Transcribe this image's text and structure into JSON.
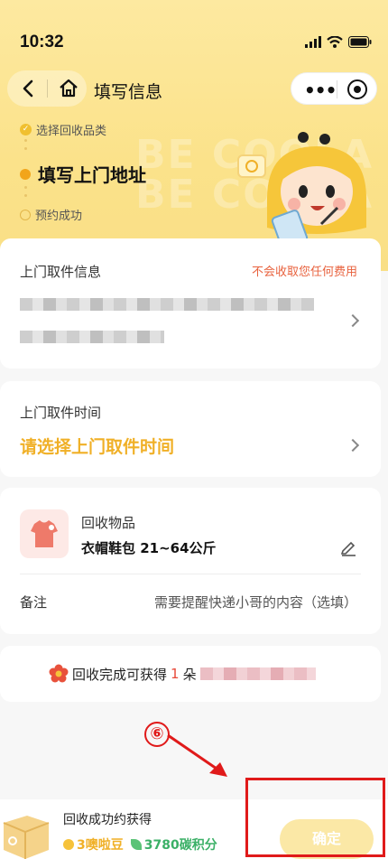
{
  "status_bar": {
    "time": "10:32"
  },
  "nav": {
    "title": "填写信息"
  },
  "steps": [
    {
      "label": "选择回收品类",
      "state": "done"
    },
    {
      "label": "填写上门地址",
      "state": "current"
    },
    {
      "label": "预约成功",
      "state": "pending"
    }
  ],
  "pickup_info": {
    "label": "上门取件信息",
    "fee_note": "不会收取您任何费用"
  },
  "pickup_time": {
    "label": "上门取件时间",
    "placeholder": "请选择上门取件时间"
  },
  "recycle_item": {
    "label": "回收物品",
    "value": "衣帽鞋包  21~64公斤"
  },
  "remark": {
    "label": "备注",
    "placeholder": "需要提醒快递小哥的内容（选填）"
  },
  "reward": {
    "prefix": "回收完成可获得",
    "count": "1",
    "unit": "朵"
  },
  "annotation": {
    "number": "⑥"
  },
  "bottom": {
    "title": "回收成功约获得",
    "beans": "3噢啦豆",
    "carbon": "3780碳积分",
    "confirm": "确定"
  },
  "colors": {
    "accent": "#f0b027",
    "danger": "#e8623e",
    "annotation": "#e01a1a"
  }
}
